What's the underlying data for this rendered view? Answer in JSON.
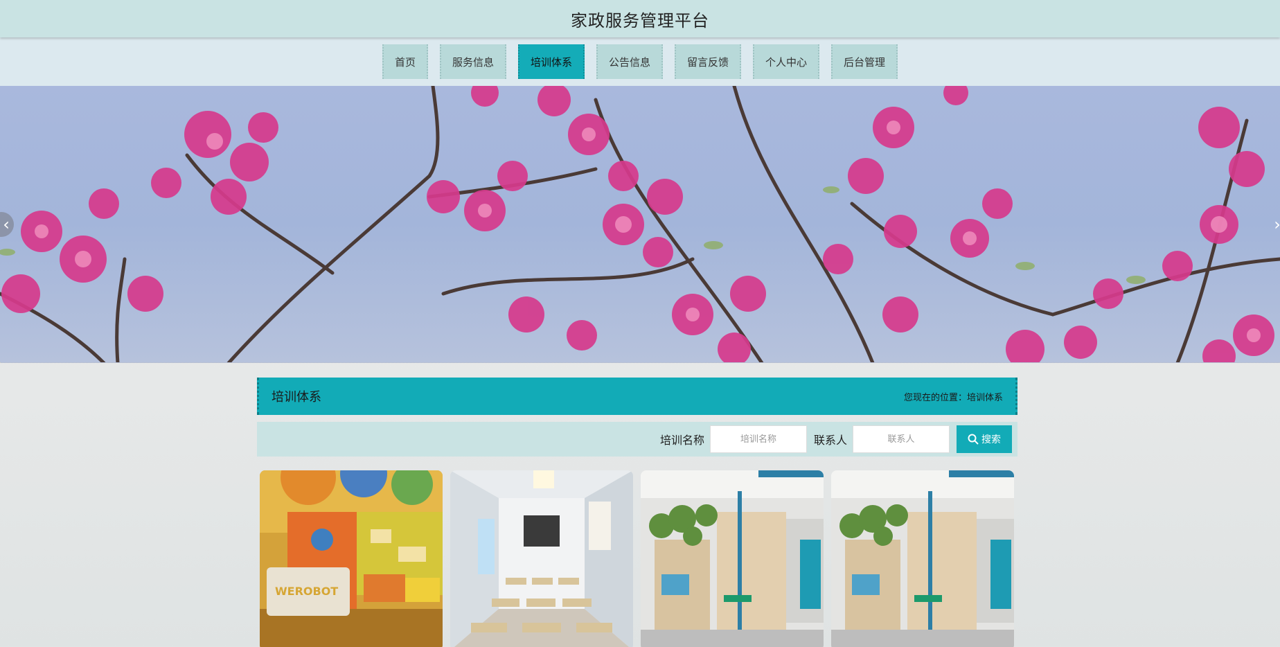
{
  "header": {
    "title": "家政服务管理平台"
  },
  "nav": {
    "items": [
      {
        "label": "首页"
      },
      {
        "label": "服务信息"
      },
      {
        "label": "培训体系"
      },
      {
        "label": "公告信息"
      },
      {
        "label": "留言反馈"
      },
      {
        "label": "个人中心"
      },
      {
        "label": "后台管理"
      }
    ],
    "active": "培训体系"
  },
  "banner": {
    "prev_icon": "chevron-left-icon",
    "next_icon": "chevron-right-icon"
  },
  "section": {
    "title": "培训体系",
    "breadcrumb_prefix": "您现在的位置：",
    "breadcrumb_current": "培训体系"
  },
  "search": {
    "name_label": "培训名称",
    "name_placeholder": "培训名称",
    "contact_label": "联系人",
    "contact_placeholder": "联系人",
    "button_label": "搜索",
    "button_icon": "search-icon"
  },
  "cards": [
    {
      "image": "training-room-reception",
      "sign_text": "WEROBOT"
    },
    {
      "image": "classroom-interior"
    },
    {
      "image": "study-cubicles-plants"
    },
    {
      "image": "study-cubicles-plants"
    }
  ],
  "colors": {
    "accent": "#12abb7",
    "topbar": "#c9e3e3",
    "navbar": "#dce9ef",
    "nav_item": "#b8d9d9"
  }
}
